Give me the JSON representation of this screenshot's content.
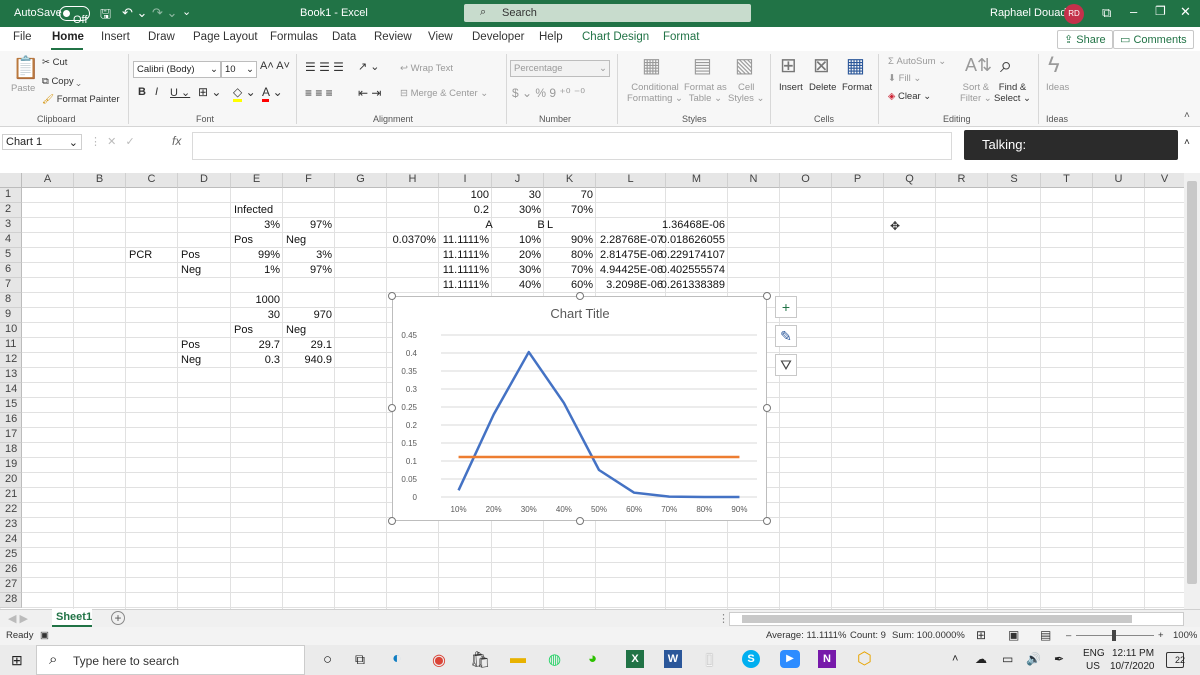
{
  "titlebar": {
    "autosave": "AutoSave",
    "toggle": "Off",
    "file": "Book1 - Excel",
    "search": "Search",
    "user": "Raphael Douady",
    "initials": "RD"
  },
  "tabs": [
    "File",
    "Home",
    "Insert",
    "Draw",
    "Page Layout",
    "Formulas",
    "Data",
    "Review",
    "View",
    "Developer",
    "Help",
    "Chart Design",
    "Format"
  ],
  "share": "Share",
  "comments": "Comments",
  "ribbon": {
    "clipboard": {
      "paste": "Paste",
      "cut": "Cut",
      "copy": "Copy",
      "painter": "Format Painter",
      "group": "Clipboard"
    },
    "font": {
      "name": "Calibri (Body)",
      "size": "10",
      "group": "Font"
    },
    "alignment": {
      "wrap": "Wrap Text",
      "merge": "Merge & Center",
      "group": "Alignment"
    },
    "number": {
      "format": "Percentage",
      "group": "Number"
    },
    "styles": {
      "cond": "Conditional",
      "cond2": "Formatting",
      "table": "Format as",
      "table2": "Table",
      "cell": "Cell",
      "cell2": "Styles",
      "group": "Styles"
    },
    "cells": {
      "insert": "Insert",
      "delete": "Delete",
      "format": "Format",
      "group": "Cells"
    },
    "editing": {
      "autosum": "AutoSum",
      "fill": "Fill",
      "clear": "Clear",
      "sort": "Sort &",
      "sort2": "Filter",
      "find": "Find &",
      "find2": "Select",
      "group": "Editing"
    },
    "ideas": {
      "label": "Ideas",
      "group": "Ideas"
    }
  },
  "namebox": "Chart 1",
  "fx": "fx",
  "talking": "Talking:",
  "columns": [
    "A",
    "B",
    "C",
    "D",
    "E",
    "F",
    "G",
    "H",
    "I",
    "J",
    "K",
    "L",
    "M",
    "N",
    "O",
    "P",
    "Q",
    "R",
    "S",
    "T",
    "U",
    "V"
  ],
  "rows": [
    "1",
    "2",
    "3",
    "4",
    "5",
    "6",
    "7",
    "8",
    "9",
    "10",
    "11",
    "12",
    "13",
    "14",
    "15",
    "16",
    "17",
    "18",
    "19",
    "20",
    "21",
    "22",
    "23",
    "24",
    "25",
    "26",
    "27",
    "28"
  ],
  "cells": {
    "I1": "100",
    "J1": "30",
    "K1": "70",
    "E2": "Infected",
    "I2": "0.2",
    "J2": "30%",
    "K2": "70%",
    "E3": "3%",
    "F3": "97%",
    "I3": "A",
    "J3": "B",
    "K3": "L",
    "M3": "1.36468E-06",
    "E4": "Pos",
    "F4": "Neg",
    "H4": "0.0370%",
    "I4": "11.1111%",
    "J4": "10%",
    "K4": "90%",
    "L4": "2.28768E-07",
    "M4": "0.018626055",
    "C5": "PCR",
    "D5": "Pos",
    "E5": "99%",
    "F5": "3%",
    "I5": "11.1111%",
    "J5": "20%",
    "K5": "80%",
    "L5": "2.81475E-06",
    "M5": "0.229174107",
    "D6": "Neg",
    "E6": "1%",
    "F6": "97%",
    "I6": "11.1111%",
    "J6": "30%",
    "K6": "70%",
    "L6": "4.94425E-06",
    "M6": "0.402555574",
    "I7": "11.1111%",
    "J7": "40%",
    "K7": "60%",
    "L7": "3.2098E-06",
    "M7": "0.261338389",
    "E8": "1000",
    "E9": "30",
    "F9": "970",
    "E10": "Pos",
    "F10": "Neg",
    "D11": "Pos",
    "E11": "29.7",
    "F11": "29.1",
    "D12": "Neg",
    "E12": "0.3",
    "F12": "940.9"
  },
  "chart_data": {
    "type": "line",
    "title": "Chart Title",
    "categories": [
      "10%",
      "20%",
      "30%",
      "40%",
      "50%",
      "60%",
      "70%",
      "80%",
      "90%"
    ],
    "series": [
      {
        "color": "#4472c4",
        "values": [
          0.0186,
          0.2292,
          0.4026,
          0.2613,
          0.075,
          0.012,
          0.001,
          0.0001,
          0.0
        ]
      },
      {
        "color": "#ed7d31",
        "values": [
          0.1111,
          0.1111,
          0.1111,
          0.1111,
          0.1111,
          0.1111,
          0.1111,
          0.1111,
          0.1111
        ]
      }
    ],
    "yticks": [
      "0",
      "0.05",
      "0.1",
      "0.15",
      "0.2",
      "0.25",
      "0.3",
      "0.35",
      "0.4",
      "0.45"
    ],
    "ylim": [
      0,
      0.45
    ],
    "grid": true
  },
  "sheet": "Sheet1",
  "status": {
    "ready": "Ready",
    "average": "Average: 11.1111%",
    "count": "Count: 9",
    "sum": "Sum: 100.0000%",
    "zoom": "100%"
  },
  "taskbar": {
    "search": "Type here to search",
    "lang1": "ENG",
    "lang2": "US",
    "time": "12:11 PM",
    "date": "10/7/2020",
    "notif": "22"
  }
}
